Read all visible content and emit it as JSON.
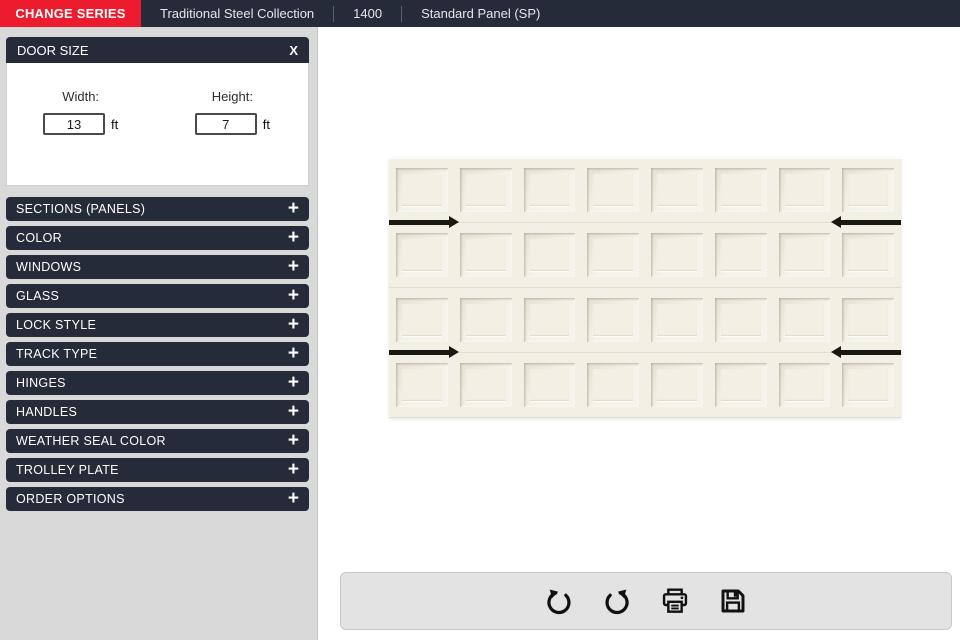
{
  "topbar": {
    "change_series_label": "CHANGE SERIES",
    "items": [
      "Traditional Steel Collection",
      "1400",
      "Standard Panel (SP)"
    ]
  },
  "door_size": {
    "title": "DOOR SIZE",
    "width": {
      "label": "Width:",
      "value": "13",
      "unit": "ft"
    },
    "height": {
      "label": "Height:",
      "value": "7",
      "unit": "ft"
    }
  },
  "sidebar": {
    "sections": [
      "SECTIONS (PANELS)",
      "COLOR",
      "WINDOWS",
      "GLASS",
      "LOCK STYLE",
      "TRACK TYPE",
      "HINGES",
      "HANDLES",
      "WEATHER SEAL COLOR",
      "TROLLEY PLATE",
      "ORDER OPTIONS"
    ]
  },
  "door_preview": {
    "rows": 4,
    "columns": 8,
    "hinge_seams": [
      0,
      2
    ],
    "door_color": "#f2efe4",
    "hardware_color": "#1a1812"
  },
  "toolbar": {
    "buttons": [
      "undo",
      "redo",
      "print",
      "save"
    ]
  },
  "icons": {
    "close": "X",
    "plus": "+"
  },
  "colors": {
    "accent_red": "#ec1b2d",
    "navy": "#252b39",
    "sidebar_bg": "#d9d9d9",
    "toolbar_bg": "#e3e3e3"
  }
}
